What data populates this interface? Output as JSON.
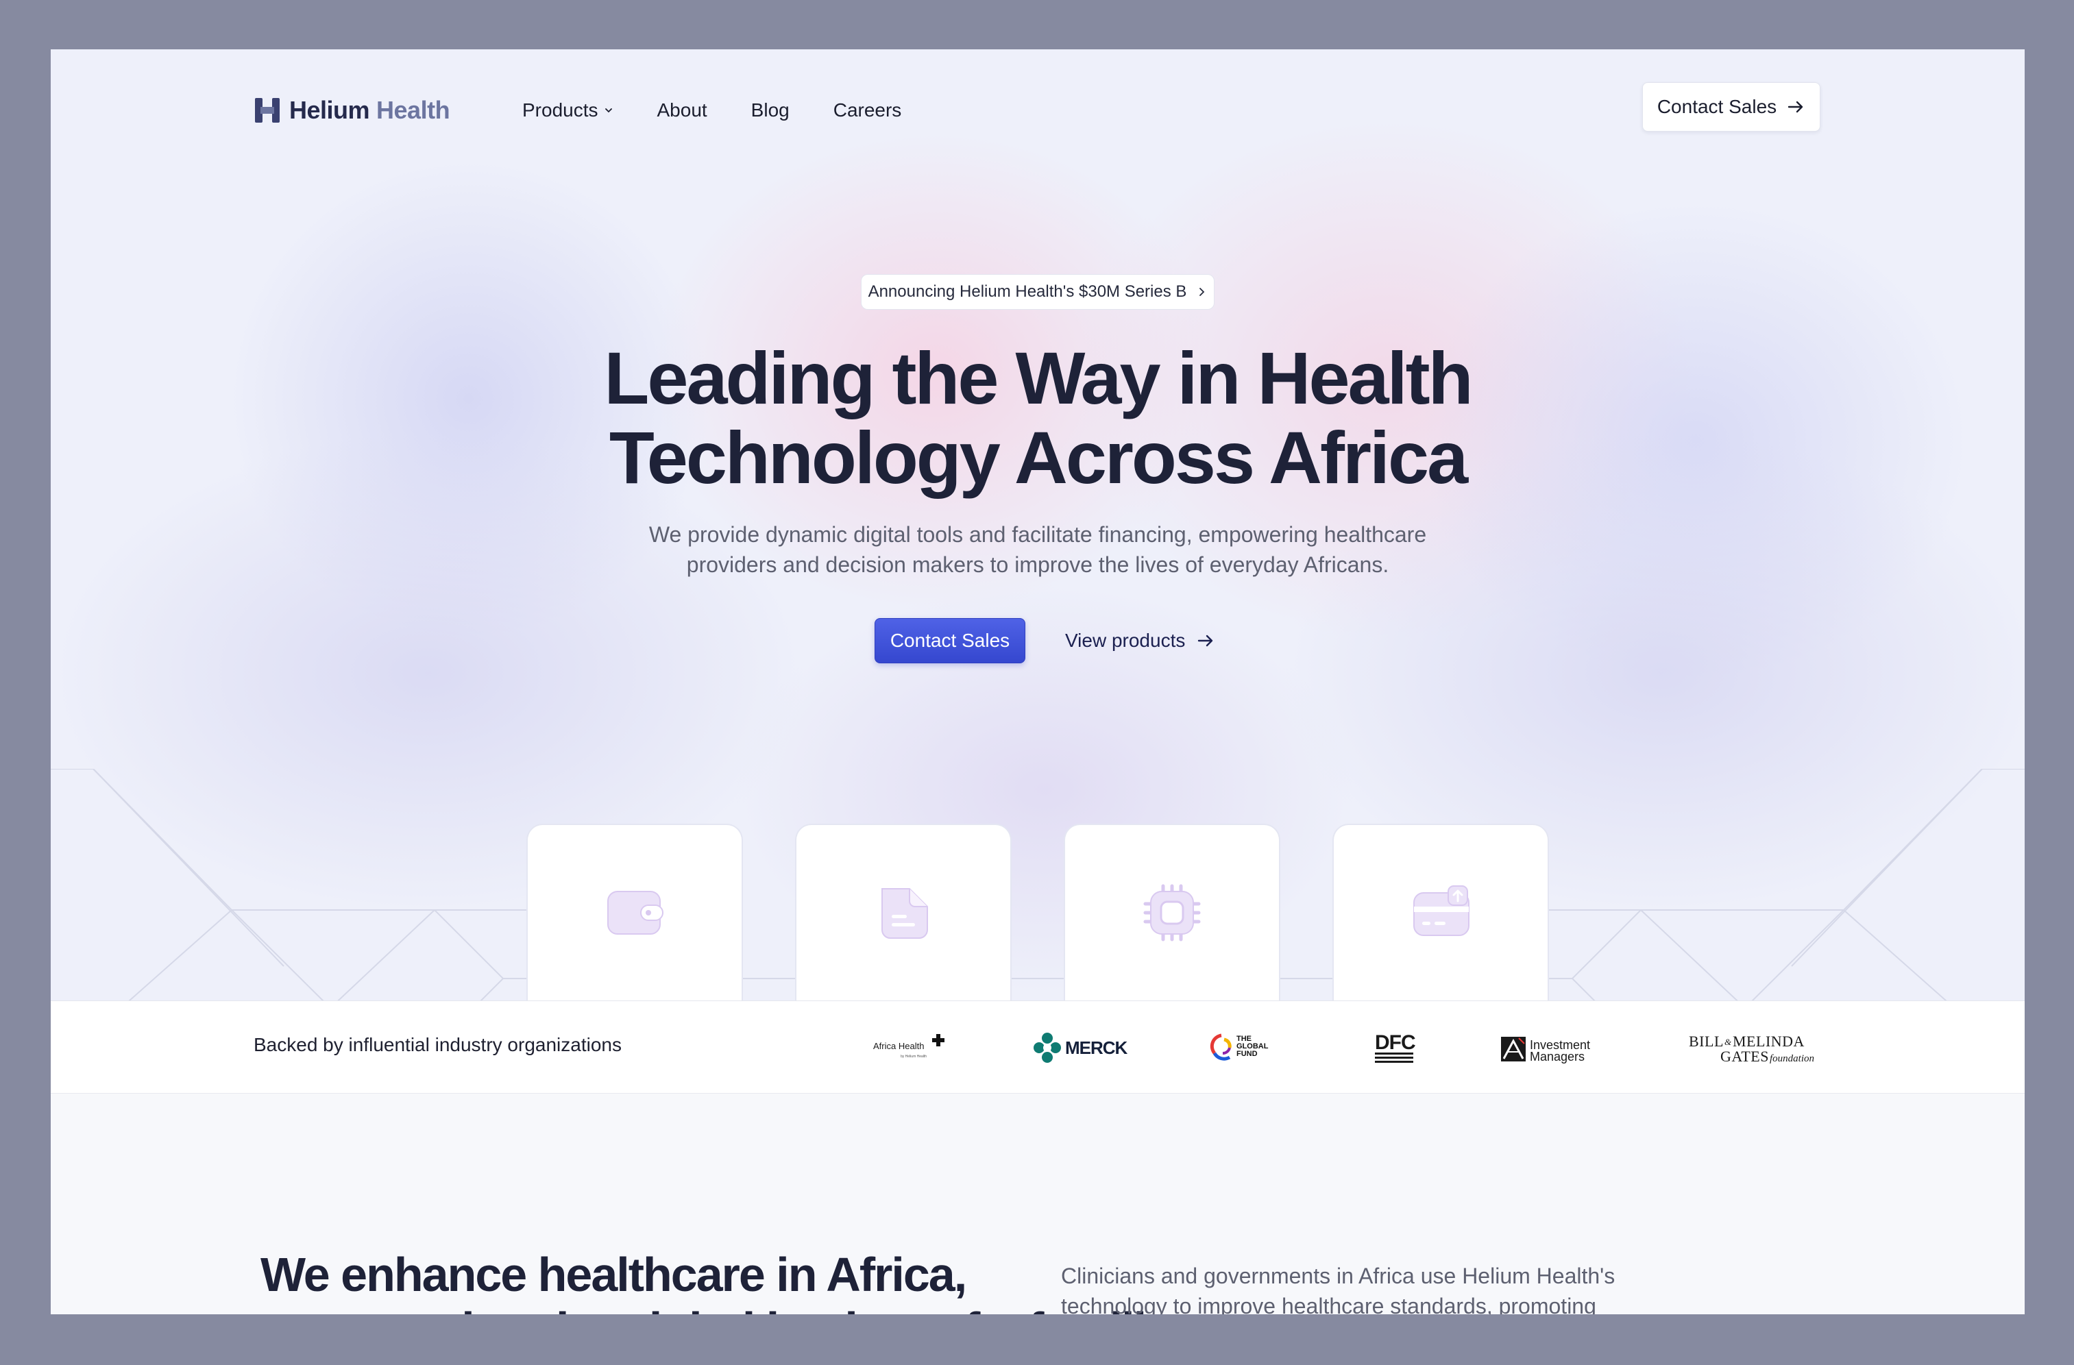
{
  "colors": {
    "brand_dark": "#252a4c",
    "brand_muted": "#6c75a0",
    "primary_button": "#3b4ed8",
    "heading": "#1e2238",
    "body_text": "#5d6070",
    "icon_tint": "#e6dcf6",
    "icon_stroke": "#d7c8ef",
    "outer_frame": "#868aa0"
  },
  "header": {
    "logo_word1": "Helium",
    "logo_word2": "Health",
    "nav": [
      {
        "label": "Products",
        "has_dropdown": true
      },
      {
        "label": "About"
      },
      {
        "label": "Blog"
      },
      {
        "label": "Careers"
      }
    ],
    "cta_label": "Contact Sales"
  },
  "hero": {
    "announcement": "Announcing Helium Health's $30M Series B",
    "headline_line1": "Leading the Way in Health",
    "headline_line2": "Technology Across Africa",
    "subtext_line1": "We provide dynamic digital tools and facilitate financing, empowering healthcare",
    "subtext_line2": "providers and decision makers to improve the lives of everyday Africans.",
    "primary_cta": "Contact Sales",
    "secondary_cta": "View products",
    "cards": [
      {
        "icon": "wallet-icon"
      },
      {
        "icon": "document-icon"
      },
      {
        "icon": "chip-icon"
      },
      {
        "icon": "card-upload-icon"
      }
    ]
  },
  "backers": {
    "label": "Backed by influential industry organizations",
    "partners": [
      {
        "name": "Africa Health",
        "caption": "by Helium Health"
      },
      {
        "name": "MERCK"
      },
      {
        "name": "THE GLOBAL FUND"
      },
      {
        "name": "DFC"
      },
      {
        "name": "AXA Investment Managers",
        "line1": "Investment",
        "line2": "Managers"
      },
      {
        "name": "BILL & MELINDA GATES foundation",
        "line1": "BILL",
        "amp": "&",
        "line1b": "MELINDA",
        "line2": "GATES",
        "line2b": "foundation"
      }
    ]
  },
  "section2": {
    "title_line1": "We enhance healthcare in Africa,",
    "title_line2": "empowering the global leaders of a familiar",
    "text_line1": "Clinicians and governments in Africa use Helium Health's",
    "text_line2": "technology to improve healthcare standards, promoting"
  }
}
